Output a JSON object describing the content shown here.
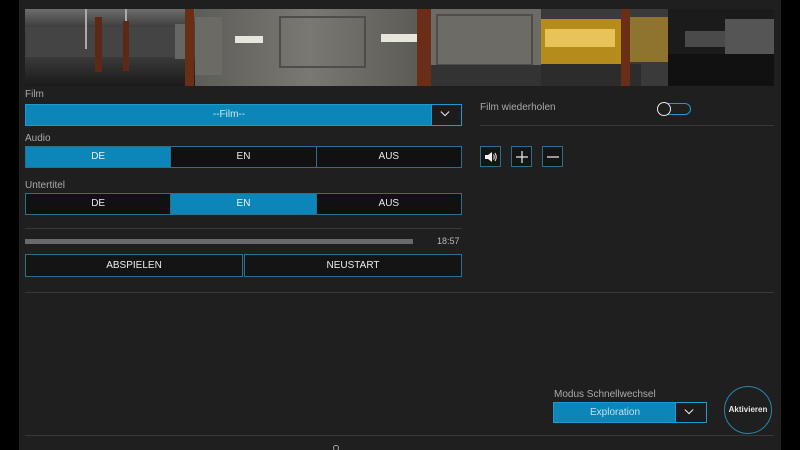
{
  "film": {
    "label": "Film",
    "selected": "--Film--"
  },
  "audio": {
    "label": "Audio",
    "options": [
      "DE",
      "EN",
      "AUS"
    ],
    "selected": "DE"
  },
  "subtitles": {
    "label": "Untertitel",
    "options": [
      "DE",
      "EN",
      "AUS"
    ],
    "selected": "EN"
  },
  "playback": {
    "progress": 1.0,
    "time": "18:57",
    "play_label": "ABSPIELEN",
    "restart_label": "NEUSTART"
  },
  "repeat": {
    "label": "Film wiederholen",
    "enabled": false
  },
  "volume": {
    "icons": [
      "speaker-icon",
      "plus-icon",
      "minus-icon"
    ]
  },
  "quick_switch": {
    "label": "Modus Schnellwechsel",
    "selected": "Exploration"
  },
  "activate_label": "Aktivieren",
  "colors": {
    "accent": "#0c86b8",
    "panel": "#1f1f1f",
    "border": "#2b6f8c"
  }
}
